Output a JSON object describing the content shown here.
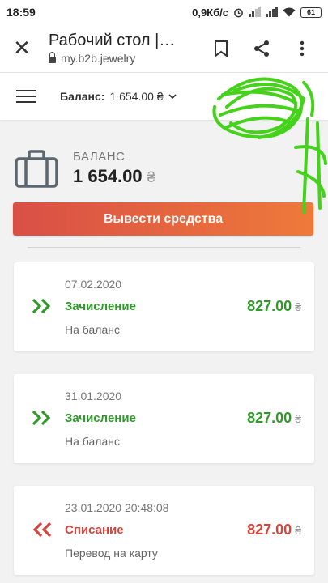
{
  "statusbar": {
    "time": "18:59",
    "speed": "0,9Кб/с",
    "battery": "61"
  },
  "browser": {
    "title": "Рабочий стол |…",
    "url": "my.b2b.jewelry"
  },
  "header": {
    "balance_label": "Баланс:",
    "balance_value": "1 654.00 ₴"
  },
  "summary": {
    "label": "БАЛАНС",
    "amount": "1 654.00",
    "currency": "₴"
  },
  "actions": {
    "withdraw_label": "Вывести средства"
  },
  "colors": {
    "credit": "#2f9a2a",
    "debit": "#d8433c",
    "button_start": "#d94f46",
    "button_end": "#ee7a3a",
    "scribble": "#44d21a"
  },
  "transactions": [
    {
      "date": "07.02.2020",
      "type": "Зачисление",
      "description": "На баланс",
      "amount": "827.00",
      "currency": "₴",
      "kind": "credit",
      "icon": "double-chevron-right-icon"
    },
    {
      "date": "31.01.2020",
      "type": "Зачисление",
      "description": "На баланс",
      "amount": "827.00",
      "currency": "₴",
      "kind": "credit",
      "icon": "double-chevron-right-icon"
    },
    {
      "date": "23.01.2020 20:48:08",
      "type": "Списание",
      "description": "Перевод на карту",
      "amount": "827.00",
      "currency": "₴",
      "kind": "debit",
      "icon": "double-chevron-left-icon"
    }
  ]
}
